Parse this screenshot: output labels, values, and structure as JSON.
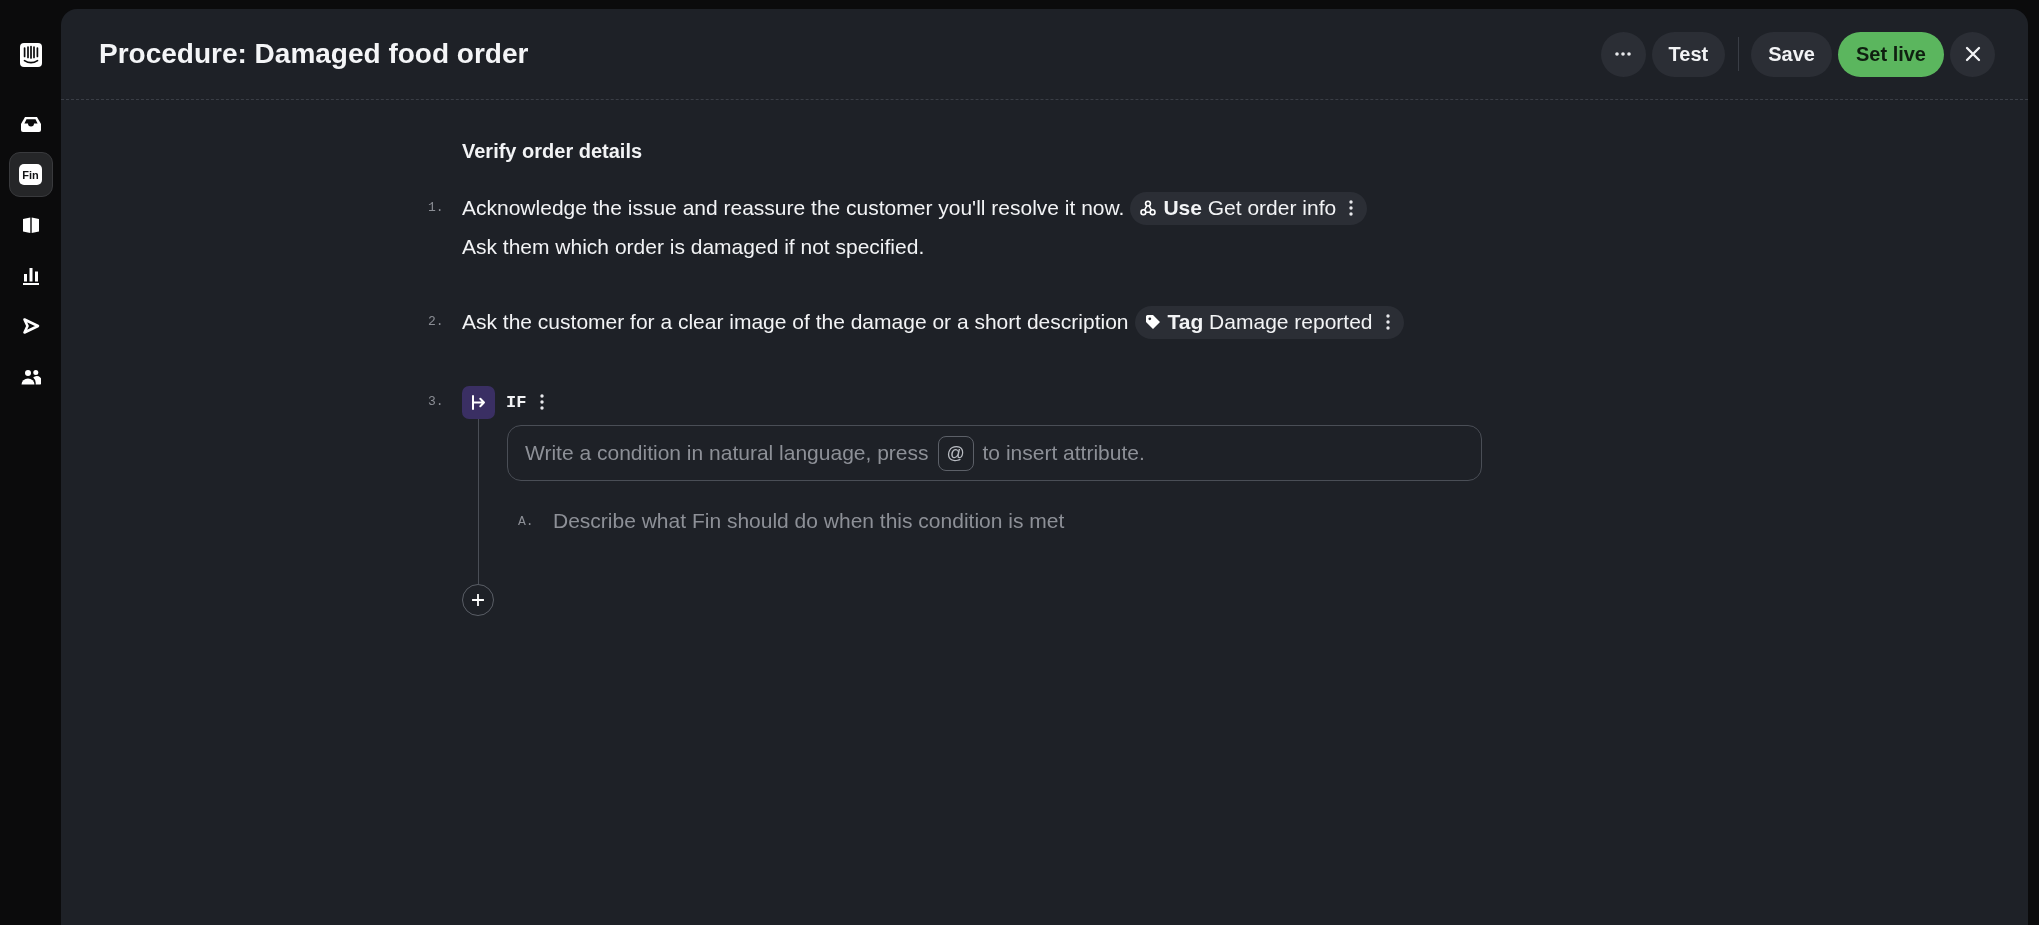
{
  "sidebar": {
    "items": [
      {
        "kind": "icon",
        "selected": false
      },
      {
        "kind": "badge",
        "label": "Fin",
        "selected": true
      },
      {
        "kind": "icon",
        "selected": false
      },
      {
        "kind": "icon",
        "selected": false
      },
      {
        "kind": "icon",
        "selected": false
      },
      {
        "kind": "icon",
        "selected": false
      }
    ]
  },
  "header": {
    "title": "Procedure: Damaged food order",
    "buttons": [
      {
        "kind": "more"
      },
      {
        "kind": "plain",
        "label": "Test"
      },
      {
        "kind": "divider"
      },
      {
        "kind": "plain",
        "label": "Save"
      },
      {
        "kind": "primary",
        "label": "Set live"
      },
      {
        "kind": "close"
      }
    ]
  },
  "section": {
    "heading": "Verify order details",
    "steps": [
      {
        "number": "1.",
        "kind": "instruction",
        "lines": [
          {
            "text": "Acknowledge the issue and reassure the customer you'll resolve it now.",
            "chip": {
              "kind": "use",
              "label": "**Use** Get order info"
            }
          },
          {
            "text": "Ask them which order is damaged if not specified."
          }
        ]
      },
      {
        "number": "2.",
        "kind": "instruction",
        "lines": [
          {
            "text": "Ask the customer for a clear image of the damage or a short description",
            "chip": {
              "kind": "tag",
              "label": "**Tag** Damage reported"
            }
          }
        ]
      },
      {
        "number": "3.",
        "kind": "condition",
        "keyword": "IF",
        "condition_field": {
          "placeholder": "Write a condition in natural language, press",
          "key": "@",
          "placeholder_end": "to insert attribute."
        },
        "branches": [
          {
            "marker": "A.",
            "placeholder": "Describe what Fin should do when this condition is met"
          }
        ]
      }
    ]
  }
}
